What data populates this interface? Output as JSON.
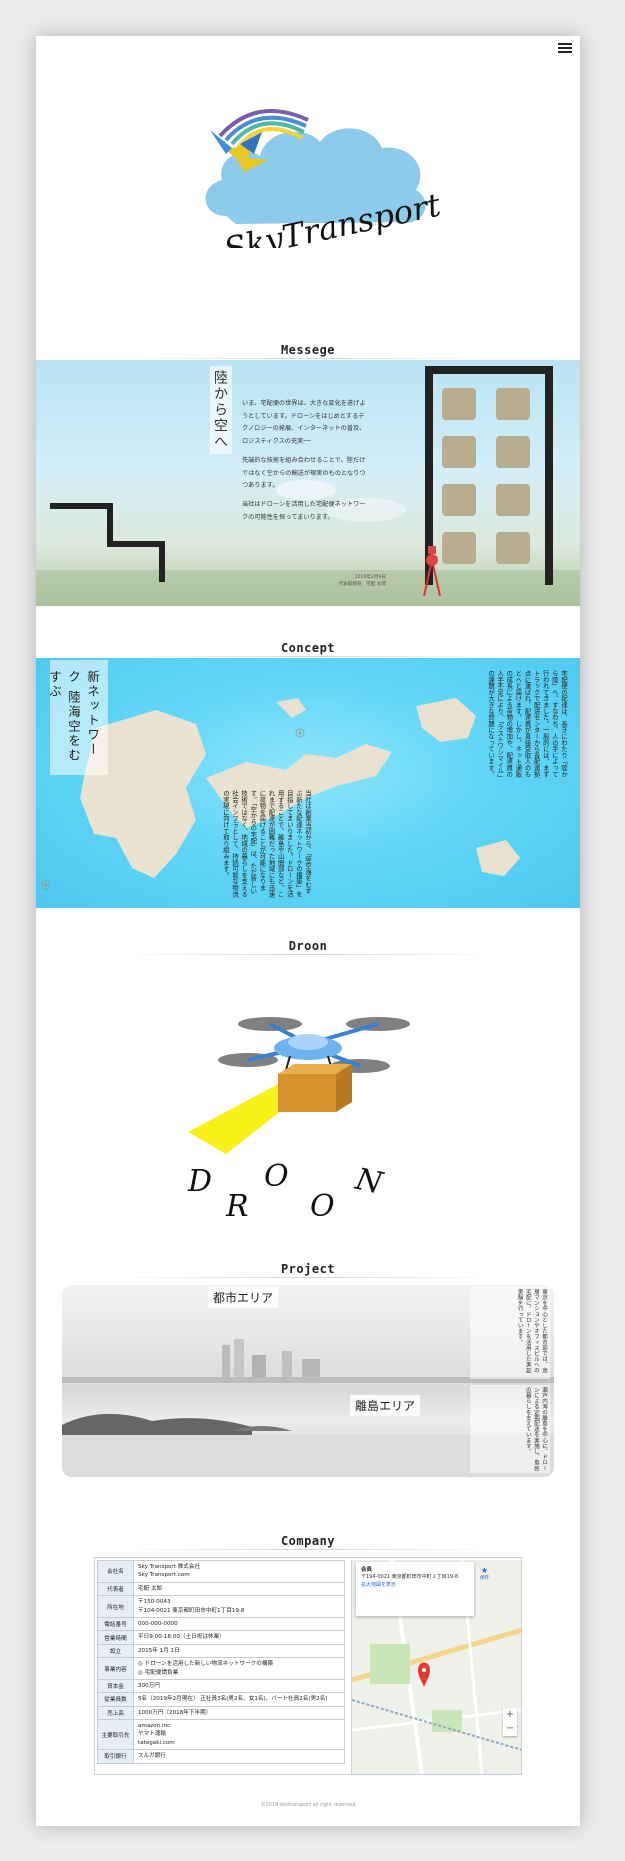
{
  "header": {
    "menu_icon": "hamburger-icon"
  },
  "logo": {
    "text": "SkyTransport"
  },
  "sections": {
    "message": "Messege",
    "concept": "Concept",
    "droon": "Droon",
    "project": "Project",
    "company": "Company"
  },
  "message": {
    "heading": "陸から空へ",
    "paragraphs": [
      "いま、宅配便の世界は、大きな変化を遂げようとしています。ドローンをはじめとするテクノロジーの発展、インターネットの普及、ロジスティクスの充実──",
      "先端的な技術を組み合わせることで、陸だけではなく空からの輸送が現実のものとなりつつあります。",
      "当社はドローンを活用した宅配便ネットワークの可能性を探ってまいります。"
    ],
    "date": "2019年2月9日",
    "signature": "代表取締役　宅配 太郎"
  },
  "concept": {
    "heading_1": "新ネットワーク",
    "heading_2": "陸海空をむすぶ",
    "text_right": "宅配便の配達は、長きにわたり「陸から陸」へ、すなわち、人の手によって行われてきました。一般的には、まずトラックで配送センターから各配達拠点に運ばれ、配達員が直接受取人のもとへと届けます。しかし、ネット通販の成長による荷物の増加や、配達員の人手不足により、「ラストワンマイル」の課題が大きな問題になっています。",
    "text_left": "当社は創業当初から、「陸空海をむすぶ新たな配達ネットワークの構築」を目指してまいりました。ドローンを活用することで、離島や山間部など、これまで配達が困難だった地域にも迅速に荷物を届けることが可能になります。「空からの宅配」は、ただ新しい技術ではなく、地域の暮らしを支える社会インフラとして、持続可能な物流の実現に向けて取り組みます。"
  },
  "droon": {
    "word": "DROON"
  },
  "project": {
    "urban_label": "都市エリア",
    "island_label": "離島エリア",
    "urban_text": "東京を中心とした都市部では、高層マンションやオフィスビルへの宅配に、ドローンを活用した実証実験を行っています。",
    "island_text": "瀬戸内海の離島を中心に、ドローンによる定期配送を実施し、島民の暮らしを支えています。"
  },
  "company": {
    "rows": [
      {
        "label": "会社名",
        "value": "Sky Transport 株式会社\nSky Transport.com"
      },
      {
        "label": "代表者",
        "value": "宅配 太郎"
      },
      {
        "label": "所在地",
        "value": "〒150-0043\n〒104-0021 東京都町田市中町1丁目19-8"
      },
      {
        "label": "電話番号",
        "value": "000-000-0000"
      },
      {
        "label": "営業時間",
        "value": "平日9:00-18:00（土日祝は休業）"
      },
      {
        "label": "設立",
        "value": "2015年 1月 1日"
      },
      {
        "label": "事業内容",
        "value": "◎ ドローンを活用した新しい物流ネットワークの構築\n◎ 宅配便請負業"
      },
      {
        "label": "資本金",
        "value": "300万円"
      },
      {
        "label": "従業員数",
        "value": "5名（2019年2月現在） 正社員3名(男2名、女1名)、パート社員2名(男2名)"
      },
      {
        "label": "売上高",
        "value": "1000万円（2018年下半期）"
      },
      {
        "label": "主要取引先",
        "value": "amazon.inc\nヤマト運輸\ntategaki.com"
      },
      {
        "label": "取引銀行",
        "value": "スルガ銀行"
      }
    ],
    "map": {
      "place": "会員",
      "address": "〒194-0021 東京都町田市中町１丁目19-8",
      "link": "拡大地図を表示",
      "save": "保存"
    }
  },
  "footer": {
    "copyright": "©2019 skytransport all right reserved"
  }
}
